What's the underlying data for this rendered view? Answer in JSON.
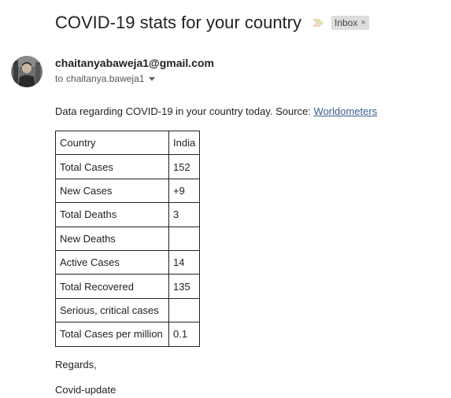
{
  "email": {
    "subject": "COVID-19 stats for your country",
    "label": "Inbox",
    "label_close": "×",
    "sender": "chaitanyabaweja1@gmail.com",
    "recipient_prefix": "to",
    "recipient": "chaitanya.baweja1",
    "intro_text": "Data regarding COVID-19 in your country today. Source: ",
    "source_link": "Worldometers"
  },
  "table": {
    "rows": [
      {
        "key": "Country",
        "value": "India"
      },
      {
        "key": "Total Cases",
        "value": "152"
      },
      {
        "key": "New Cases",
        "value": "+9"
      },
      {
        "key": "Total Deaths",
        "value": "3"
      },
      {
        "key": "New Deaths",
        "value": ""
      },
      {
        "key": "Active Cases",
        "value": "14"
      },
      {
        "key": "Total Recovered",
        "value": "135"
      },
      {
        "key": "Serious, critical cases",
        "value": ""
      },
      {
        "key": "Total Cases per million",
        "value": "0.1"
      }
    ]
  },
  "closing": {
    "regards": "Regards,",
    "signature": "Covid-update"
  },
  "icons": {
    "importance": "importance-marker-icon",
    "label_close": "close-icon",
    "dropdown": "chevron-down-icon",
    "avatar": "avatar"
  },
  "colors": {
    "link": "#3a5d8f",
    "label_chip_bg": "#dddddd"
  }
}
